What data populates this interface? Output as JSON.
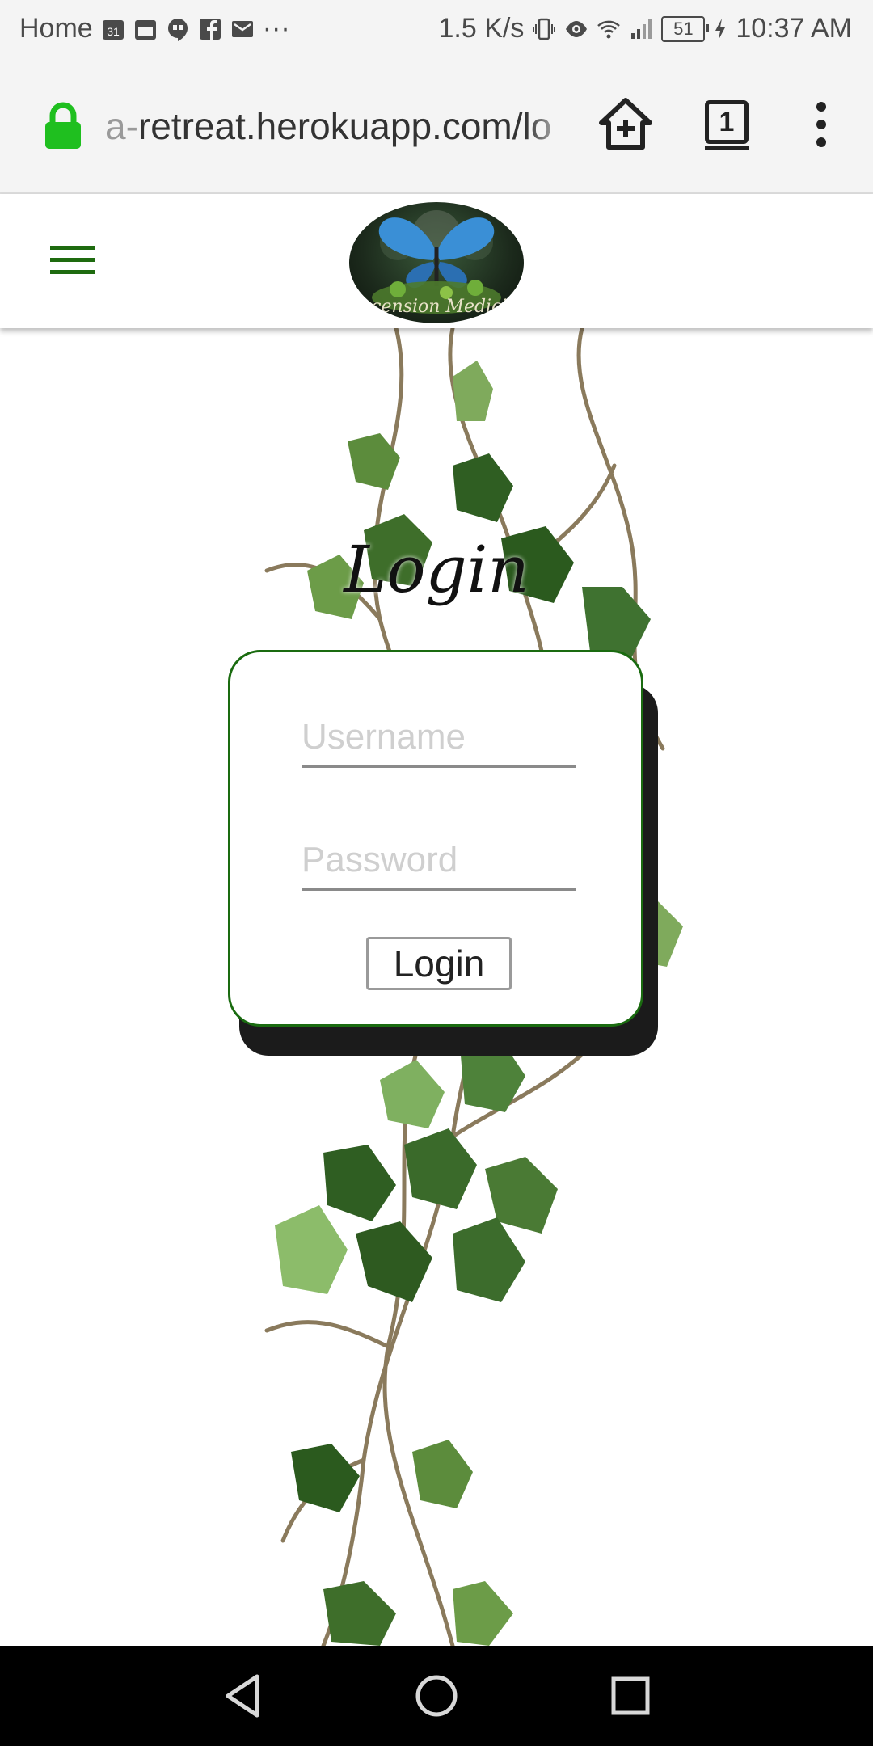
{
  "status_bar": {
    "home_label": "Home",
    "calendar_day": "31",
    "more_icons": "···",
    "network_speed": "1.5 K/s",
    "battery_level": "51",
    "time": "10:37 AM"
  },
  "url_bar": {
    "url_faded": "a-",
    "url_main": "retreat.herokuapp.com/lo",
    "tab_count": "1",
    "lock_color": "#1fbf1f"
  },
  "site_header": {
    "logo_text": "Ascension Medicine",
    "accent_color": "#1e6b0f"
  },
  "login": {
    "heading": "Login",
    "username_placeholder": "Username",
    "password_placeholder": "Password",
    "submit_label": "Login"
  },
  "icons": {
    "status": [
      "calendar-icon",
      "calendar-box-icon",
      "hangouts-icon",
      "facebook-icon",
      "gmail-icon",
      "vibrate-icon",
      "eye-icon",
      "wifi-icon",
      "signal-icon",
      "battery-icon",
      "charging-icon"
    ],
    "url_bar": [
      "lock-icon",
      "add-to-home-icon",
      "tab-switcher-icon",
      "overflow-menu-icon"
    ],
    "nav": [
      "back-icon",
      "home-icon",
      "recents-icon"
    ]
  }
}
